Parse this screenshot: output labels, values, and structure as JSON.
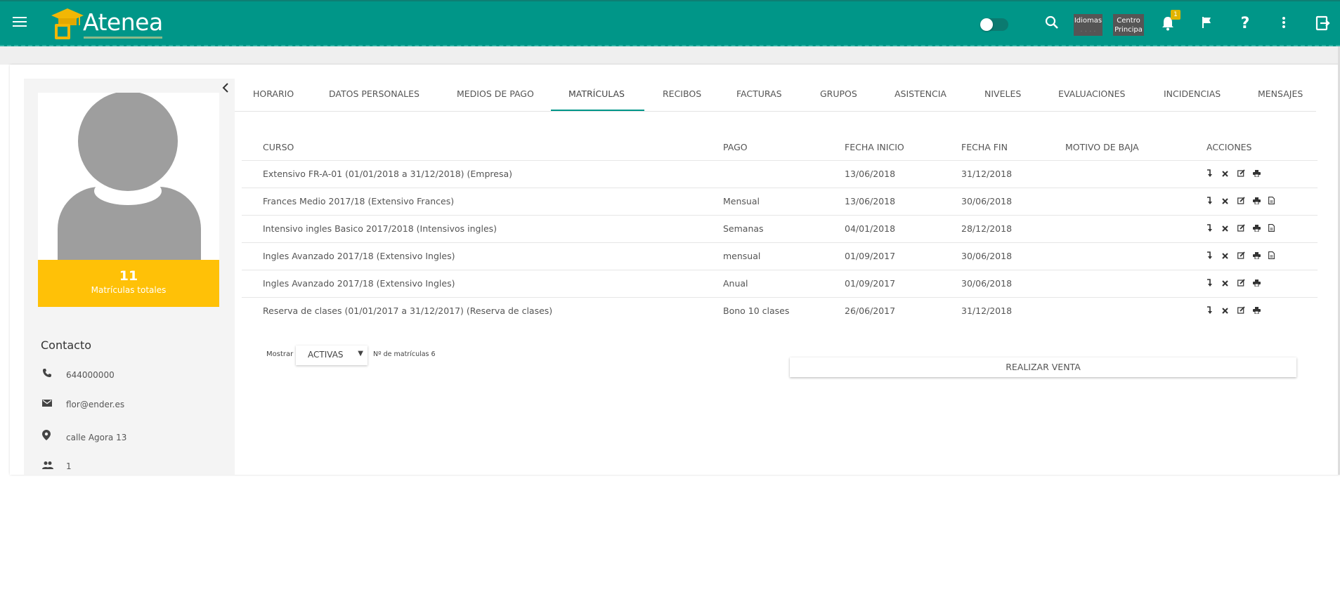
{
  "app": {
    "name": "Atenea"
  },
  "header": {
    "chip_idiomas": [
      "Idiomas",
      ". . . ."
    ],
    "chip_centro": [
      "Centro",
      "Principa"
    ],
    "notif_count": "1",
    "icons": [
      "menu-icon",
      "search-icon",
      "bell-icon",
      "flag-icon",
      "help-icon",
      "more-vert-icon",
      "logout-icon"
    ]
  },
  "profile": {
    "total": "11",
    "total_label": "Matrículas totales",
    "contact_title": "Contacto",
    "phone": "644000000",
    "email": "flor@ender.es",
    "address": "calle Agora 13",
    "group": "1"
  },
  "tabs": [
    "HORARIO",
    "DATOS PERSONALES",
    "MEDIOS DE PAGO",
    "MATRÍCULAS",
    "RECIBOS",
    "FACTURAS",
    "GRUPOS",
    "ASISTENCIA",
    "NIVELES",
    "EVALUACIONES",
    "INCIDENCIAS",
    "MENSAJES"
  ],
  "active_tab": "MATRÍCULAS",
  "table": {
    "headers": [
      "CURSO",
      "PAGO",
      "FECHA INICIO",
      "FECHA FIN",
      "MOTIVO DE BAJA",
      "ACCIONES"
    ],
    "rows": [
      {
        "curso": "Extensivo FR-A-01 (01/01/2018 a 31/12/2018) (Empresa)",
        "pago": "",
        "inicio": "13/06/2018",
        "fin": "31/12/2018",
        "motivo": "",
        "pdf": false
      },
      {
        "curso": "Frances Medio 2017/18 (Extensivo Frances)",
        "pago": "Mensual",
        "inicio": "13/06/2018",
        "fin": "30/06/2018",
        "motivo": "",
        "pdf": true
      },
      {
        "curso": "Intensivo ingles Basico 2017/2018 (Intensivos ingles)",
        "pago": "Semanas",
        "inicio": "04/01/2018",
        "fin": "28/12/2018",
        "motivo": "",
        "pdf": true
      },
      {
        "curso": "Ingles Avanzado 2017/18 (Extensivo Ingles)",
        "pago": "mensual",
        "inicio": "01/09/2017",
        "fin": "30/06/2018",
        "motivo": "",
        "pdf": true
      },
      {
        "curso": "Ingles Avanzado 2017/18 (Extensivo Ingles)",
        "pago": "Anual",
        "inicio": "01/09/2017",
        "fin": "30/06/2018",
        "motivo": "",
        "pdf": false
      },
      {
        "curso": "Reserva de clases (01/01/2017 a 31/12/2017) (Reserva de clases)",
        "pago": "Bono 10 clases",
        "inicio": "26/06/2017",
        "fin": "31/12/2018",
        "motivo": "",
        "pdf": false
      }
    ]
  },
  "footer": {
    "mostrar_label": "Mostrar",
    "filter_value": "ACTIVAS",
    "count_label": "Nº de matrículas 6",
    "venta_button": "REALIZAR VENTA"
  },
  "colors": {
    "primary": "#009688",
    "accent": "#ffc107",
    "chip": "#555555"
  }
}
